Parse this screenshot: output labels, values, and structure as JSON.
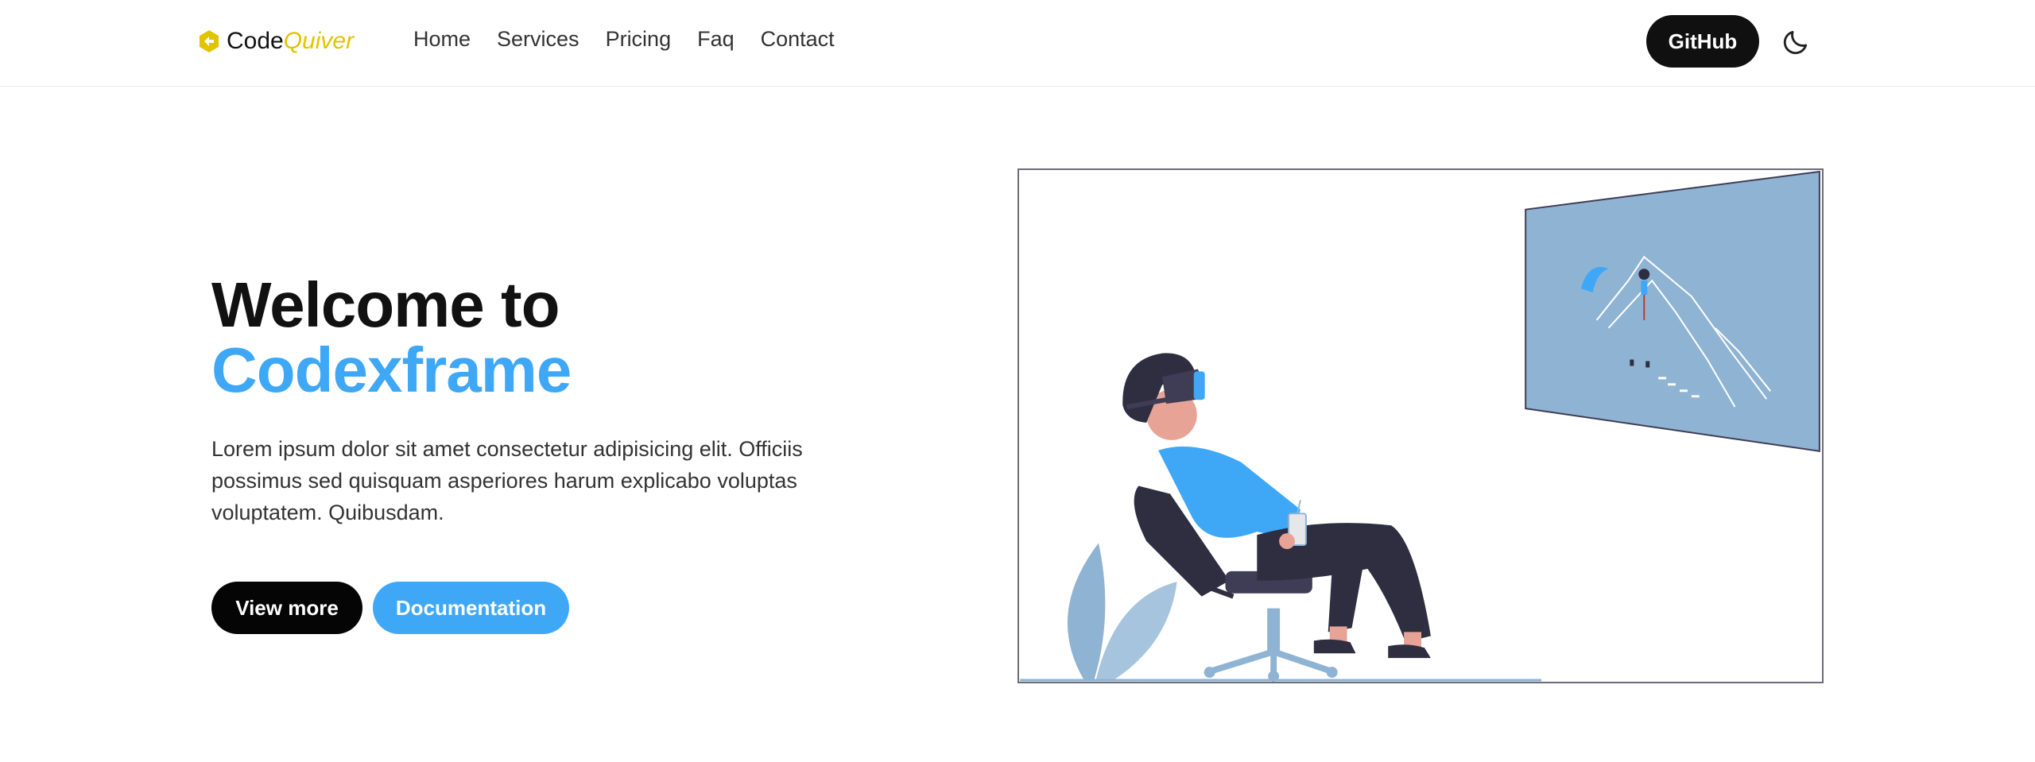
{
  "brand": {
    "name_part1": "Code",
    "name_part2": "Quiver",
    "logo_icon": "hexagon-arrows-icon",
    "accent": "#e1c400"
  },
  "nav": {
    "items": [
      "Home",
      "Services",
      "Pricing",
      "Faq",
      "Contact"
    ]
  },
  "header": {
    "github_label": "GitHub",
    "theme_icon": "moon-icon"
  },
  "hero": {
    "title_line1": "Welcome to",
    "title_line2": "Codexframe",
    "description": "Lorem ipsum dolor sit amet consectetur adipisicing elit. Officiis possimus sed quisquam asperiores harum explicabo voluptas voluptatem. Quibusdam.",
    "primary_button": "View more",
    "secondary_button": "Documentation",
    "illustration": "vr-person-in-chair-illustration"
  },
  "colors": {
    "accent_blue": "#3ea8f7",
    "dark": "#050505",
    "screen_blue": "#8fb3d3",
    "text": "#333333"
  }
}
